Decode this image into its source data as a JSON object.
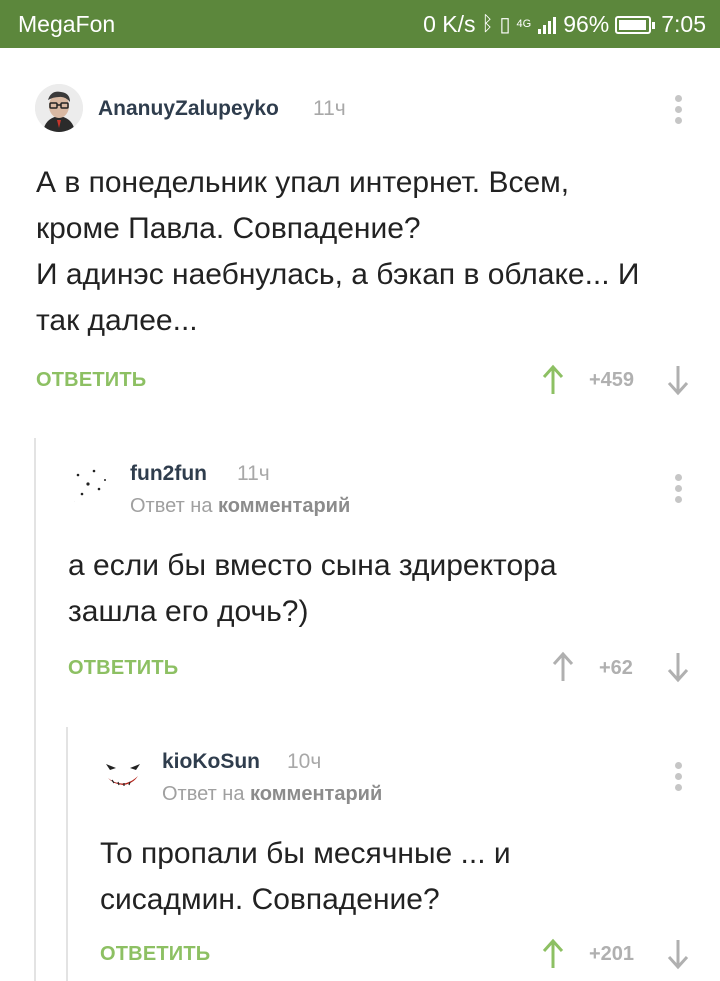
{
  "status_bar": {
    "carrier": "MegaFon",
    "speed": "0 K/s",
    "network": "4G",
    "battery": "96%",
    "battery_level": 0.96,
    "time": "7:05"
  },
  "comments": [
    {
      "username": "AnanuyZalupeyko",
      "time": "11ч",
      "lines": [
        "А в понедельник упал интернет. Всем,",
        "кроме Павла. Совпадение?",
        "И адинэс наебнулась, а бэкап в облаке... И",
        "так далее..."
      ],
      "reply_label": "ОТВЕТИТЬ",
      "rating": "+459",
      "up_voted": true
    },
    {
      "username": "fun2fun",
      "time": "11ч",
      "reply_to_prefix": "Ответ на",
      "reply_to_target": "комментарий",
      "lines": [
        "а если бы вместо сына здиректора",
        "зашла его дочь?)"
      ],
      "reply_label": "ОТВЕТИТЬ",
      "rating": "+62",
      "up_voted": false
    },
    {
      "username": "kioKoSun",
      "time": "10ч",
      "reply_to_prefix": "Ответ на",
      "reply_to_target": "комментарий",
      "lines": [
        "То пропали бы месячные ... и",
        "сисадмин. Совпадение?"
      ],
      "reply_label": "ОТВЕТИТЬ",
      "rating": "+201",
      "up_voted": true
    }
  ],
  "colors": {
    "status_bar": "#5c873c",
    "accent_green": "#8dc063",
    "username": "#2f3d4d",
    "muted": "#a8a8a8"
  }
}
